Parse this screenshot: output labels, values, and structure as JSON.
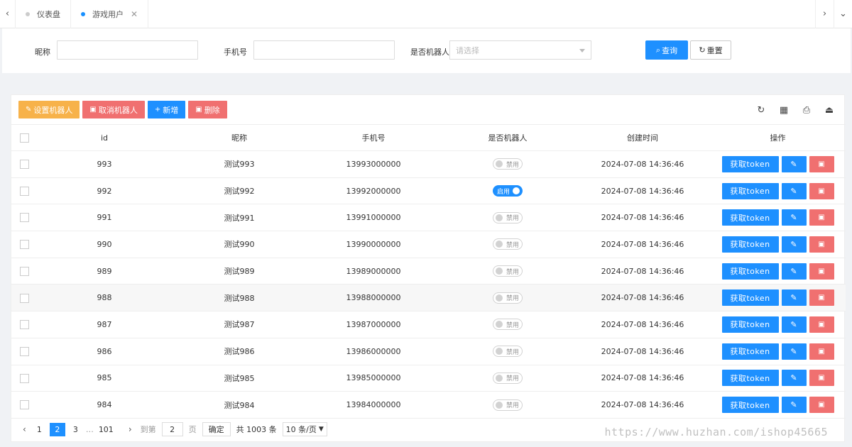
{
  "tabs": [
    {
      "label": "仪表盘",
      "active": false
    },
    {
      "label": "游戏用户",
      "active": true
    }
  ],
  "search": {
    "nickname_label": "昵称",
    "phone_label": "手机号",
    "robot_label": "是否机器人",
    "robot_placeholder": "请选择",
    "query_label": "查询",
    "reset_label": "重置"
  },
  "toolbar": {
    "set_robot": "设置机器人",
    "cancel_robot": "取消机器人",
    "add": "新增",
    "delete": "删除"
  },
  "table": {
    "headers": [
      "id",
      "昵称",
      "手机号",
      "是否机器人",
      "创建时间",
      "操作"
    ],
    "rows": [
      {
        "id": "993",
        "nick": "测试993",
        "phone": "13993000000",
        "robot": "禁用",
        "on": false,
        "time": "2024-07-08 14:36:46"
      },
      {
        "id": "992",
        "nick": "测试992",
        "phone": "13992000000",
        "robot": "启用",
        "on": true,
        "time": "2024-07-08 14:36:46"
      },
      {
        "id": "991",
        "nick": "测试991",
        "phone": "13991000000",
        "robot": "禁用",
        "on": false,
        "time": "2024-07-08 14:36:46"
      },
      {
        "id": "990",
        "nick": "测试990",
        "phone": "13990000000",
        "robot": "禁用",
        "on": false,
        "time": "2024-07-08 14:36:46"
      },
      {
        "id": "989",
        "nick": "测试989",
        "phone": "13989000000",
        "robot": "禁用",
        "on": false,
        "time": "2024-07-08 14:36:46"
      },
      {
        "id": "988",
        "nick": "测试988",
        "phone": "13988000000",
        "robot": "禁用",
        "on": false,
        "time": "2024-07-08 14:36:46"
      },
      {
        "id": "987",
        "nick": "测试987",
        "phone": "13987000000",
        "robot": "禁用",
        "on": false,
        "time": "2024-07-08 14:36:46"
      },
      {
        "id": "986",
        "nick": "测试986",
        "phone": "13986000000",
        "robot": "禁用",
        "on": false,
        "time": "2024-07-08 14:36:46"
      },
      {
        "id": "985",
        "nick": "测试985",
        "phone": "13985000000",
        "robot": "禁用",
        "on": false,
        "time": "2024-07-08 14:36:46"
      },
      {
        "id": "984",
        "nick": "测试984",
        "phone": "13984000000",
        "robot": "禁用",
        "on": false,
        "time": "2024-07-08 14:36:46"
      }
    ],
    "token_label": "获取token"
  },
  "pager": {
    "pages": [
      "1",
      "2",
      "3",
      "…",
      "101"
    ],
    "current": "2",
    "goto_label": "到第",
    "goto_value": "2",
    "page_unit": "页",
    "confirm": "确定",
    "total": "共 1003 条",
    "size": "10 条/页"
  },
  "watermark": "https://www.huzhan.com/ishop45665"
}
